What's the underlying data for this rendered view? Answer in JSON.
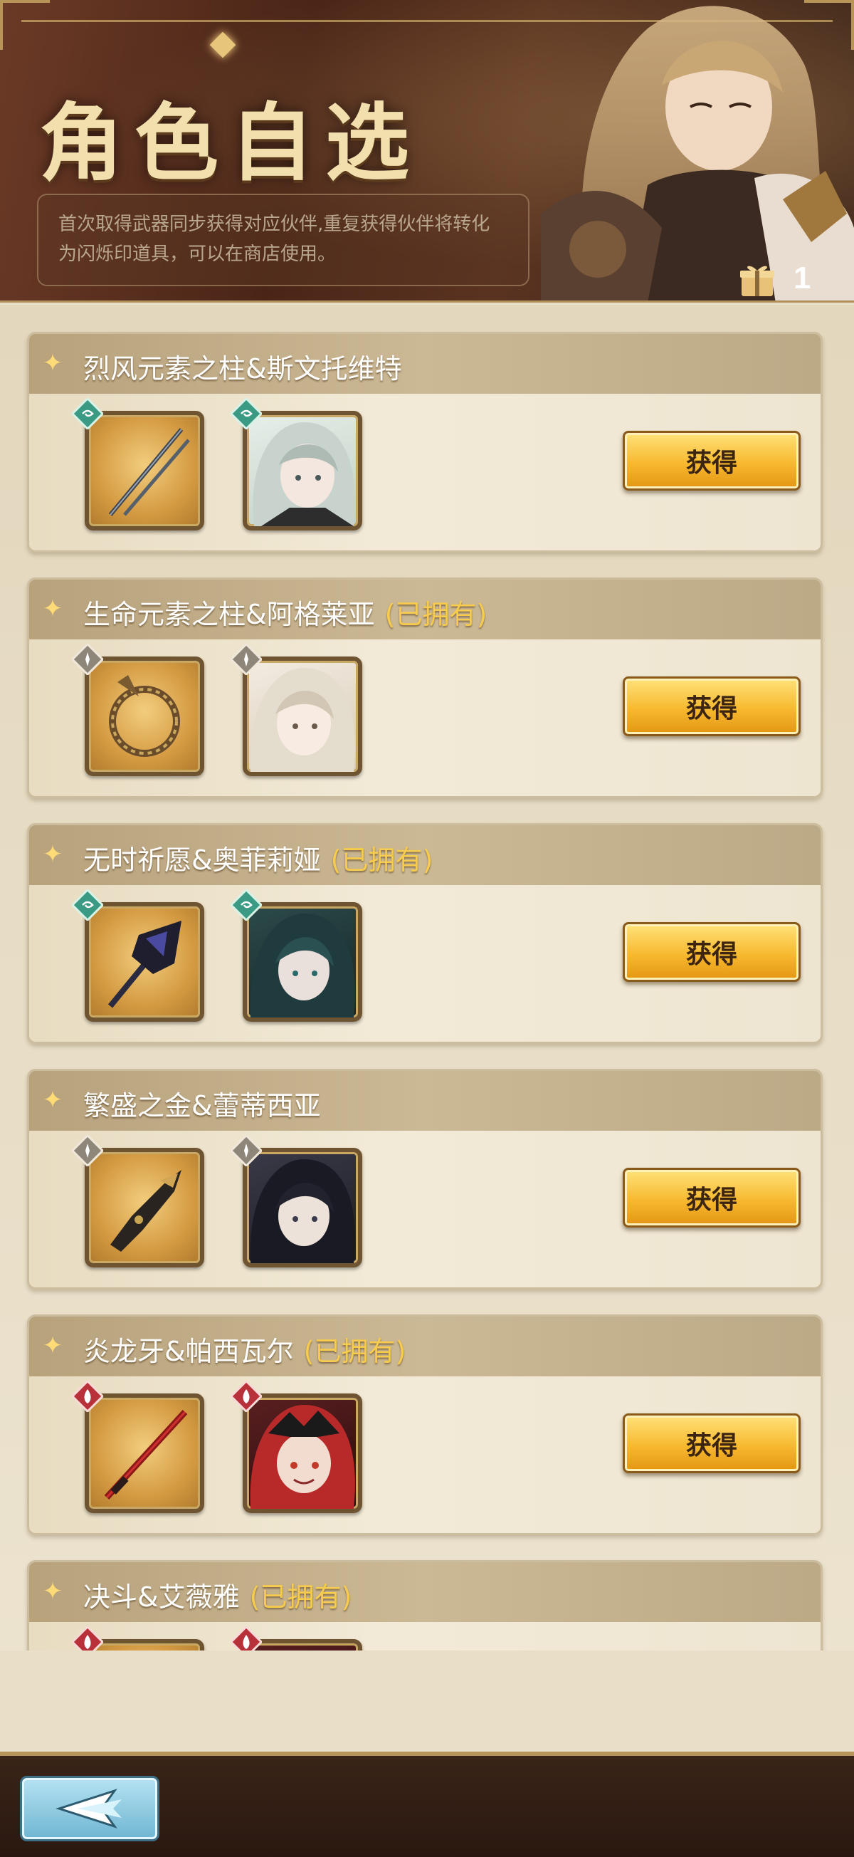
{
  "header": {
    "title": "角色自选",
    "description": "首次取得武器同步获得对应伙伴,重复获得伙伴将转化为闪烁印道具，可以在商店使用。",
    "gift_count": "1",
    "gift_icon": "gift-icon"
  },
  "colors": {
    "title_gold": "#f2dfae",
    "owned_tag": "#f6cb4e",
    "button_gold": "#f7b92f",
    "element_wind": "#3a9a83",
    "element_light": "#8e8678",
    "element_fire": "#b8303a"
  },
  "owned_label": "(已拥有)",
  "get_label": "获得",
  "items": [
    {
      "title": "烈风元素之柱&斯文托维特",
      "owned": false,
      "element": "wind"
    },
    {
      "title": "生命元素之柱&阿格莱亚",
      "owned": true,
      "element": "light"
    },
    {
      "title": "无时祈愿&奥菲莉娅",
      "owned": true,
      "element": "wind"
    },
    {
      "title": "繁盛之金&蕾蒂西亚",
      "owned": false,
      "element": "light"
    },
    {
      "title": "炎龙牙&帕西瓦尔",
      "owned": true,
      "element": "fire"
    },
    {
      "title": "决斗&艾薇雅",
      "owned": true,
      "element": "fire"
    }
  ],
  "back_icon": "back-arrow-icon"
}
